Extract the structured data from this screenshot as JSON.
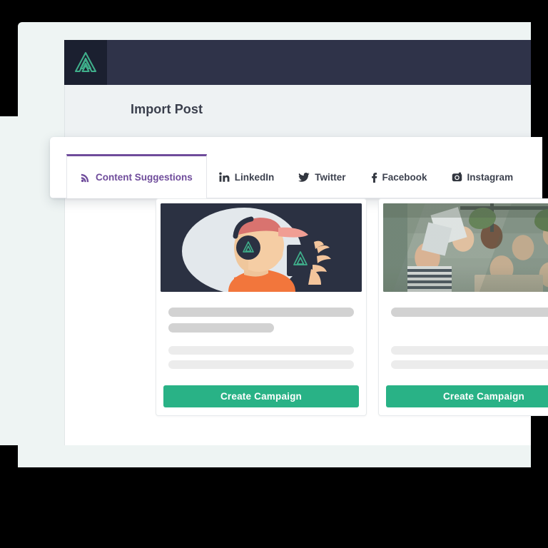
{
  "app": {
    "logo_icon": "anvil-triangle-logo",
    "brand_dark": "#2f3349",
    "logo_tile_color": "#1b2030",
    "accent_green": "#29b286",
    "accent_purple": "#6f4c9b",
    "page_background": "#eef4f3"
  },
  "header": {
    "page_title": "Import Post"
  },
  "tabs": [
    {
      "id": "content-suggestions",
      "label": "Content Suggestions",
      "icon": "rss-icon",
      "active": true
    },
    {
      "id": "linkedin",
      "label": "LinkedIn",
      "icon": "linkedin-icon",
      "active": false
    },
    {
      "id": "twitter",
      "label": "Twitter",
      "icon": "twitter-icon",
      "active": false
    },
    {
      "id": "facebook",
      "label": "Facebook",
      "icon": "facebook-icon",
      "active": false
    },
    {
      "id": "instagram",
      "label": "Instagram",
      "icon": "instagram-icon",
      "active": false
    }
  ],
  "cards": [
    {
      "media_type": "illustration",
      "media_alt": "person wearing backwards cap and headphones drinking from a branded mug",
      "skeleton_lines": [
        {
          "width": "100%",
          "tone": "dark"
        },
        {
          "width": "57%",
          "tone": "dark"
        },
        {
          "width": "100%",
          "tone": "light"
        },
        {
          "width": "100%",
          "tone": "light"
        }
      ],
      "button_label": "Create Campaign"
    },
    {
      "media_type": "photo",
      "media_alt": "group of colleagues cheering around a laptop in an office",
      "skeleton_lines": [
        {
          "width": "100%",
          "tone": "dark"
        },
        {
          "width": "100%",
          "tone": "light"
        },
        {
          "width": "100%",
          "tone": "light"
        }
      ],
      "button_label": "Create Campaign"
    }
  ]
}
